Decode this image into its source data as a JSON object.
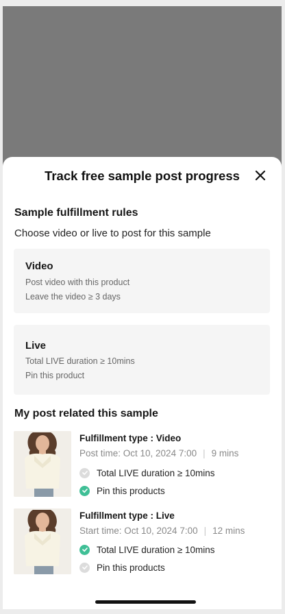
{
  "sheet": {
    "title": "Track free sample post progress",
    "rules": {
      "heading": "Sample fulfillment rules",
      "subtitle": "Choose video or live to post for this sample",
      "cards": [
        {
          "title": "Video",
          "lines": [
            "Post video with this product",
            "Leave the video ≥ 3 days"
          ]
        },
        {
          "title": "Live",
          "lines": [
            "Total LIVE duration ≥ 10mins",
            "Pin this product"
          ]
        }
      ]
    },
    "posts": {
      "heading": "My post related this sample",
      "items": [
        {
          "type": "Fulfillment type : Video",
          "time": "Post time: Oct 10, 2024 7:00",
          "separator": "|",
          "duration": "9 mins",
          "checks": [
            {
              "label": "Total LIVE duration ≥ 10mins",
              "done": false
            },
            {
              "label": "Pin this products",
              "done": true
            }
          ]
        },
        {
          "type": "Fulfillment type : Live",
          "time": "Start time: Oct 10, 2024 7:00",
          "separator": "|",
          "duration": "12 mins",
          "checks": [
            {
              "label": "Total LIVE duration ≥ 10mins",
              "done": true
            },
            {
              "label": "Pin this products",
              "done": false
            }
          ]
        }
      ]
    }
  },
  "icons": {
    "close": "close-icon",
    "check": "check-circle-icon",
    "thumbnail": "product-image"
  },
  "colors": {
    "check_done": "#3fbf96",
    "check_pending": "#dcdcdc",
    "overlay": "#7a7a7a"
  }
}
